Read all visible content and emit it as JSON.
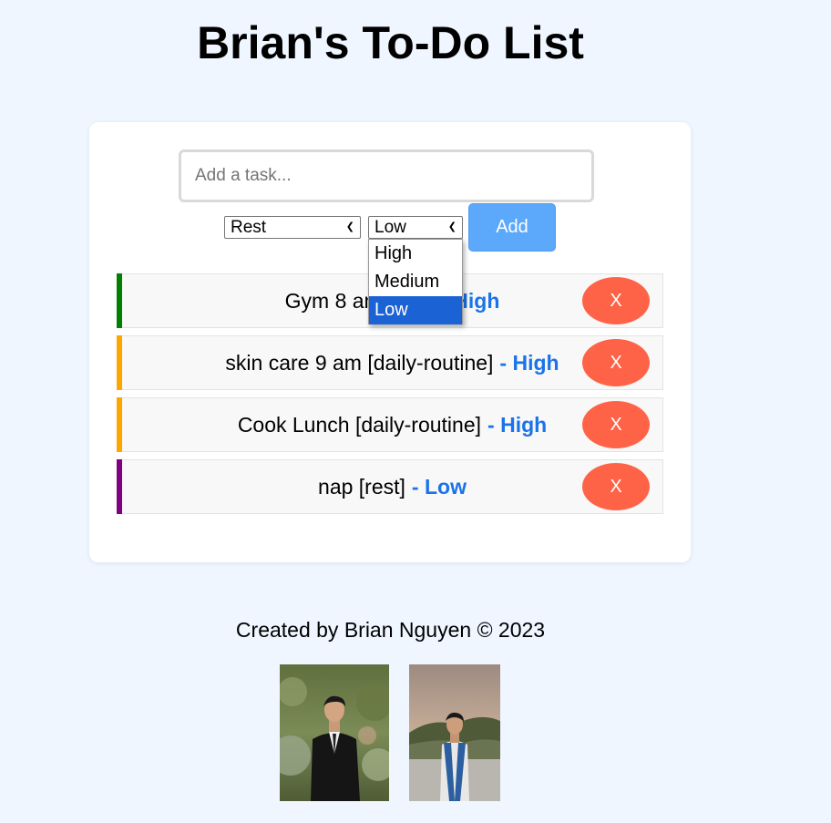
{
  "header": {
    "title": "Brian's To-Do List"
  },
  "form": {
    "placeholder": "Add a task...",
    "category_value": "Rest",
    "priority_value": "Low",
    "add_label": "Add"
  },
  "priority_dropdown": {
    "options": [
      "High",
      "Medium",
      "Low"
    ],
    "selected": "Low"
  },
  "tasks": [
    {
      "text": "Gym 8 am [rest]",
      "priority": "- High",
      "bar_color": "#008000",
      "delete_label": "X"
    },
    {
      "text": "skin care 9 am [daily-routine]",
      "priority": "- High",
      "bar_color": "#ffa500",
      "delete_label": "X"
    },
    {
      "text": "Cook Lunch [daily-routine]",
      "priority": "- High",
      "bar_color": "#ffa500",
      "delete_label": "X"
    },
    {
      "text": "nap [rest]",
      "priority": "- Low",
      "bar_color": "#800080",
      "delete_label": "X"
    }
  ],
  "footer": {
    "credit": "Created by Brian Nguyen © 2023"
  },
  "photos": [
    {
      "name": "Brian in black suit portrait"
    },
    {
      "name": "Brian in graduation stole portrait"
    }
  ],
  "colors": {
    "background": "#f0f6ff",
    "add_button": "#5ca9fb",
    "delete_button": "#ff6347",
    "priority_text": "#1a73e8",
    "dropdown_highlight": "#1b62d4"
  }
}
